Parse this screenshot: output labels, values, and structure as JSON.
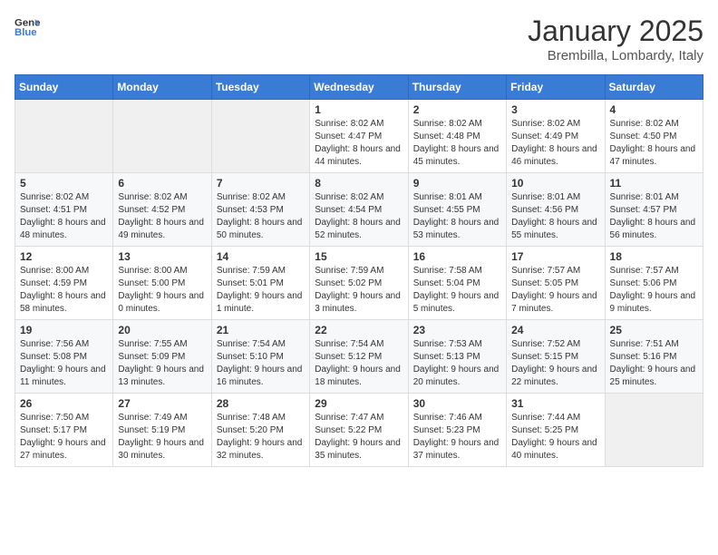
{
  "header": {
    "logo_general": "General",
    "logo_blue": "Blue",
    "month": "January 2025",
    "location": "Brembilla, Lombardy, Italy"
  },
  "weekdays": [
    "Sunday",
    "Monday",
    "Tuesday",
    "Wednesday",
    "Thursday",
    "Friday",
    "Saturday"
  ],
  "weeks": [
    [
      {
        "day": "",
        "sunrise": "",
        "sunset": "",
        "daylight": ""
      },
      {
        "day": "",
        "sunrise": "",
        "sunset": "",
        "daylight": ""
      },
      {
        "day": "",
        "sunrise": "",
        "sunset": "",
        "daylight": ""
      },
      {
        "day": "1",
        "sunrise": "Sunrise: 8:02 AM",
        "sunset": "Sunset: 4:47 PM",
        "daylight": "Daylight: 8 hours and 44 minutes."
      },
      {
        "day": "2",
        "sunrise": "Sunrise: 8:02 AM",
        "sunset": "Sunset: 4:48 PM",
        "daylight": "Daylight: 8 hours and 45 minutes."
      },
      {
        "day": "3",
        "sunrise": "Sunrise: 8:02 AM",
        "sunset": "Sunset: 4:49 PM",
        "daylight": "Daylight: 8 hours and 46 minutes."
      },
      {
        "day": "4",
        "sunrise": "Sunrise: 8:02 AM",
        "sunset": "Sunset: 4:50 PM",
        "daylight": "Daylight: 8 hours and 47 minutes."
      }
    ],
    [
      {
        "day": "5",
        "sunrise": "Sunrise: 8:02 AM",
        "sunset": "Sunset: 4:51 PM",
        "daylight": "Daylight: 8 hours and 48 minutes."
      },
      {
        "day": "6",
        "sunrise": "Sunrise: 8:02 AM",
        "sunset": "Sunset: 4:52 PM",
        "daylight": "Daylight: 8 hours and 49 minutes."
      },
      {
        "day": "7",
        "sunrise": "Sunrise: 8:02 AM",
        "sunset": "Sunset: 4:53 PM",
        "daylight": "Daylight: 8 hours and 50 minutes."
      },
      {
        "day": "8",
        "sunrise": "Sunrise: 8:02 AM",
        "sunset": "Sunset: 4:54 PM",
        "daylight": "Daylight: 8 hours and 52 minutes."
      },
      {
        "day": "9",
        "sunrise": "Sunrise: 8:01 AM",
        "sunset": "Sunset: 4:55 PM",
        "daylight": "Daylight: 8 hours and 53 minutes."
      },
      {
        "day": "10",
        "sunrise": "Sunrise: 8:01 AM",
        "sunset": "Sunset: 4:56 PM",
        "daylight": "Daylight: 8 hours and 55 minutes."
      },
      {
        "day": "11",
        "sunrise": "Sunrise: 8:01 AM",
        "sunset": "Sunset: 4:57 PM",
        "daylight": "Daylight: 8 hours and 56 minutes."
      }
    ],
    [
      {
        "day": "12",
        "sunrise": "Sunrise: 8:00 AM",
        "sunset": "Sunset: 4:59 PM",
        "daylight": "Daylight: 8 hours and 58 minutes."
      },
      {
        "day": "13",
        "sunrise": "Sunrise: 8:00 AM",
        "sunset": "Sunset: 5:00 PM",
        "daylight": "Daylight: 9 hours and 0 minutes."
      },
      {
        "day": "14",
        "sunrise": "Sunrise: 7:59 AM",
        "sunset": "Sunset: 5:01 PM",
        "daylight": "Daylight: 9 hours and 1 minute."
      },
      {
        "day": "15",
        "sunrise": "Sunrise: 7:59 AM",
        "sunset": "Sunset: 5:02 PM",
        "daylight": "Daylight: 9 hours and 3 minutes."
      },
      {
        "day": "16",
        "sunrise": "Sunrise: 7:58 AM",
        "sunset": "Sunset: 5:04 PM",
        "daylight": "Daylight: 9 hours and 5 minutes."
      },
      {
        "day": "17",
        "sunrise": "Sunrise: 7:57 AM",
        "sunset": "Sunset: 5:05 PM",
        "daylight": "Daylight: 9 hours and 7 minutes."
      },
      {
        "day": "18",
        "sunrise": "Sunrise: 7:57 AM",
        "sunset": "Sunset: 5:06 PM",
        "daylight": "Daylight: 9 hours and 9 minutes."
      }
    ],
    [
      {
        "day": "19",
        "sunrise": "Sunrise: 7:56 AM",
        "sunset": "Sunset: 5:08 PM",
        "daylight": "Daylight: 9 hours and 11 minutes."
      },
      {
        "day": "20",
        "sunrise": "Sunrise: 7:55 AM",
        "sunset": "Sunset: 5:09 PM",
        "daylight": "Daylight: 9 hours and 13 minutes."
      },
      {
        "day": "21",
        "sunrise": "Sunrise: 7:54 AM",
        "sunset": "Sunset: 5:10 PM",
        "daylight": "Daylight: 9 hours and 16 minutes."
      },
      {
        "day": "22",
        "sunrise": "Sunrise: 7:54 AM",
        "sunset": "Sunset: 5:12 PM",
        "daylight": "Daylight: 9 hours and 18 minutes."
      },
      {
        "day": "23",
        "sunrise": "Sunrise: 7:53 AM",
        "sunset": "Sunset: 5:13 PM",
        "daylight": "Daylight: 9 hours and 20 minutes."
      },
      {
        "day": "24",
        "sunrise": "Sunrise: 7:52 AM",
        "sunset": "Sunset: 5:15 PM",
        "daylight": "Daylight: 9 hours and 22 minutes."
      },
      {
        "day": "25",
        "sunrise": "Sunrise: 7:51 AM",
        "sunset": "Sunset: 5:16 PM",
        "daylight": "Daylight: 9 hours and 25 minutes."
      }
    ],
    [
      {
        "day": "26",
        "sunrise": "Sunrise: 7:50 AM",
        "sunset": "Sunset: 5:17 PM",
        "daylight": "Daylight: 9 hours and 27 minutes."
      },
      {
        "day": "27",
        "sunrise": "Sunrise: 7:49 AM",
        "sunset": "Sunset: 5:19 PM",
        "daylight": "Daylight: 9 hours and 30 minutes."
      },
      {
        "day": "28",
        "sunrise": "Sunrise: 7:48 AM",
        "sunset": "Sunset: 5:20 PM",
        "daylight": "Daylight: 9 hours and 32 minutes."
      },
      {
        "day": "29",
        "sunrise": "Sunrise: 7:47 AM",
        "sunset": "Sunset: 5:22 PM",
        "daylight": "Daylight: 9 hours and 35 minutes."
      },
      {
        "day": "30",
        "sunrise": "Sunrise: 7:46 AM",
        "sunset": "Sunset: 5:23 PM",
        "daylight": "Daylight: 9 hours and 37 minutes."
      },
      {
        "day": "31",
        "sunrise": "Sunrise: 7:44 AM",
        "sunset": "Sunset: 5:25 PM",
        "daylight": "Daylight: 9 hours and 40 minutes."
      },
      {
        "day": "",
        "sunrise": "",
        "sunset": "",
        "daylight": ""
      }
    ]
  ]
}
